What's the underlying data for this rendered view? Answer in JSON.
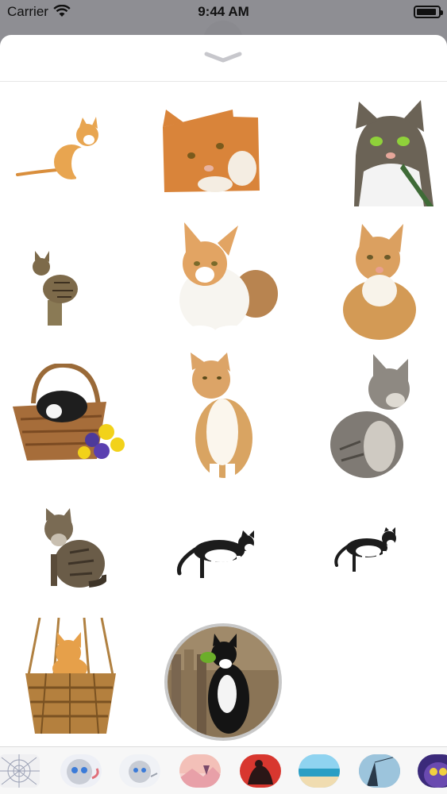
{
  "status_bar": {
    "carrier": "Carrier",
    "time": "9:44 AM",
    "wifi_icon": "wifi-icon",
    "battery_icon": "battery-icon"
  },
  "sheet": {
    "grabber_icon": "chevron-down-icon"
  },
  "stickers": [
    {
      "name": "sticker-orange-cat-sitting",
      "description_icon": "cat-icon"
    },
    {
      "name": "sticker-ginger-cat-paw",
      "description_icon": "cat-icon"
    },
    {
      "name": "sticker-tabby-white-cat-green-eyes",
      "description_icon": "cat-icon"
    },
    {
      "name": "sticker-tabby-cat-on-post",
      "description_icon": "cat-icon"
    },
    {
      "name": "sticker-orange-white-cat-lying",
      "description_icon": "cat-icon"
    },
    {
      "name": "sticker-orange-cat-sitting-2",
      "description_icon": "cat-icon"
    },
    {
      "name": "sticker-cat-in-basket-flowers",
      "description_icon": "cat-icon"
    },
    {
      "name": "sticker-orange-white-cat-upright",
      "description_icon": "cat-icon"
    },
    {
      "name": "sticker-grey-kitten",
      "description_icon": "cat-icon"
    },
    {
      "name": "sticker-maine-coon-cat",
      "description_icon": "cat-icon"
    },
    {
      "name": "sticker-tuxedo-cat-walking",
      "description_icon": "cat-icon"
    },
    {
      "name": "sticker-tuxedo-cat-walking-2",
      "description_icon": "cat-icon"
    },
    {
      "name": "sticker-kitten-hanging-basket",
      "description_icon": "cat-icon"
    },
    {
      "name": "sticker-tuxedo-cat-round-photo",
      "description_icon": "cat-icon"
    }
  ],
  "tray": {
    "items": [
      "app-store-icon",
      "kitten-app-icon",
      "kitten-app-icon-2",
      "sunset-app-icon",
      "red-animal-app-icon",
      "beach-app-icon",
      "fishing-app-icon",
      "owl-app-icon"
    ]
  },
  "colors": {
    "background": "#8e8e93",
    "sheet": "#ffffff",
    "tray": "#f7f7f7"
  }
}
